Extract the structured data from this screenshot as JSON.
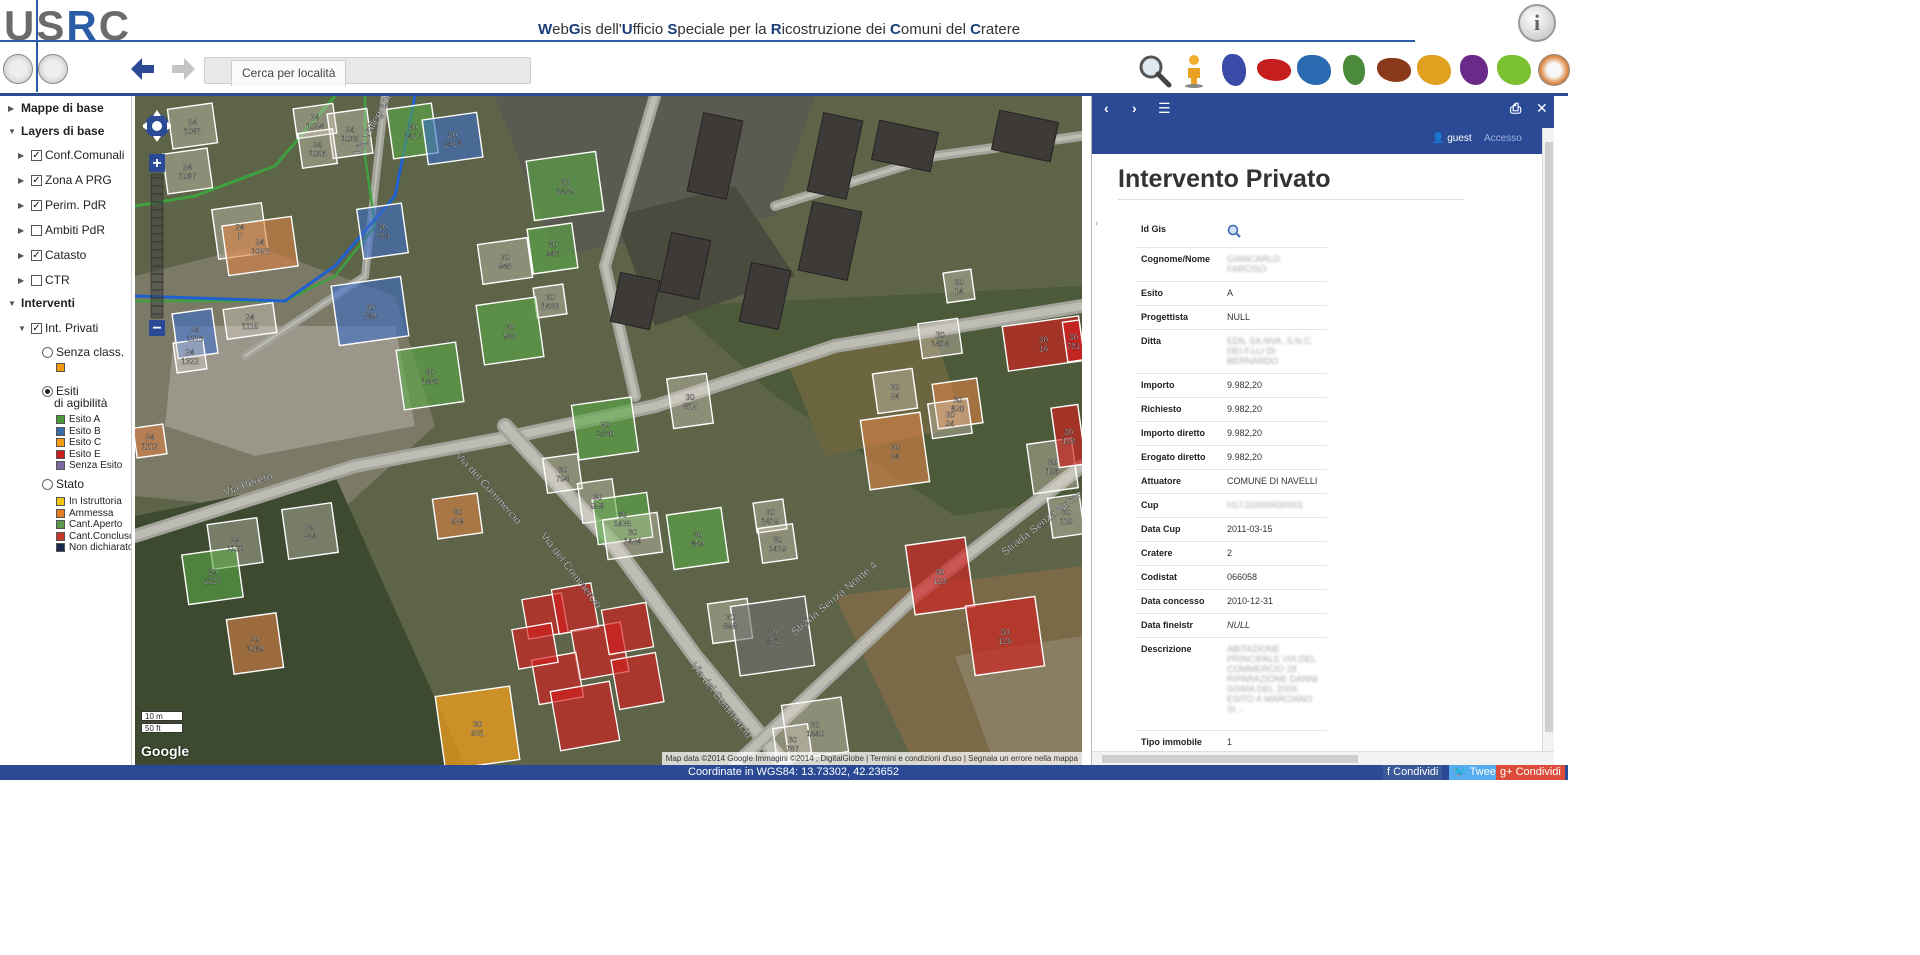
{
  "header": {
    "logo": {
      "u": "U",
      "s": "S",
      "r": "R",
      "c": "C"
    },
    "title_parts": [
      {
        "b": "W",
        "t": "eb"
      },
      {
        "b": "G",
        "t": "is dell'"
      },
      {
        "b": "U",
        "t": "fficio "
      },
      {
        "b": "S",
        "t": "peciale per la "
      },
      {
        "b": "R",
        "t": "icostruzione dei "
      },
      {
        "b": "C",
        "t": "omuni del "
      },
      {
        "b": "C",
        "t": "ratere"
      }
    ],
    "info_label": "i",
    "nav_back": "🡄",
    "nav_forward": "🡆",
    "search_tab_label": "Cerca per località"
  },
  "toolbar": {
    "icons": [
      "search-icon",
      "person-icon",
      "map-region-1",
      "map-region-2",
      "map-region-3",
      "map-region-4",
      "map-region-5",
      "map-region-6",
      "map-region-7",
      "map-region-8",
      "map-region-9"
    ],
    "map_colors": [
      "#3a4aa8",
      "#c41e1e",
      "#2a6ab0",
      "#4a8a3a",
      "#8a3a1a",
      "#e0a020",
      "#6a2a8a",
      "#7ac030"
    ]
  },
  "sidebar": {
    "sections": {
      "base_maps": "Mappe di base",
      "base_layers": "Layers di base",
      "interventi": "Interventi"
    },
    "layers": [
      {
        "label": "Conf.Comunali",
        "checked": true
      },
      {
        "label": "Zona A PRG",
        "checked": true
      },
      {
        "label": "Perim. PdR",
        "checked": true
      },
      {
        "label": "Ambiti PdR",
        "checked": false
      },
      {
        "label": "Catasto",
        "checked": true
      },
      {
        "label": "CTR",
        "checked": false
      }
    ],
    "int_privati": {
      "label": "Int. Privati",
      "checked": true
    },
    "radio_senza": "Senza class.",
    "radio_esiti_1": "Esiti",
    "radio_esiti_2": "di agibilità",
    "radio_stato": "Stato",
    "senza_color": "#f39c12",
    "esiti_legend": [
      {
        "label": "Esito A",
        "color": "#4a9a3a"
      },
      {
        "label": "Esito B",
        "color": "#3a6aa8"
      },
      {
        "label": "Esito C",
        "color": "#f39c12"
      },
      {
        "label": "Esito E",
        "color": "#c82020"
      },
      {
        "label": "Senza Esito",
        "color": "#7a6aa0"
      }
    ],
    "stato_legend": [
      {
        "label": "In Istruttoria",
        "color": "#f1c40f"
      },
      {
        "label": "Ammessa",
        "color": "#e67e22"
      },
      {
        "label": "Cant.Aperto",
        "color": "#5a9a4a"
      },
      {
        "label": "Cant.Concluso",
        "color": "#c0392b"
      },
      {
        "label": "Non dichiarato",
        "color": "#1a2a4a"
      }
    ]
  },
  "map": {
    "scale_m": "10 m",
    "scale_ft": "50 ft",
    "google": "Google",
    "attribution": "Map data ©2014 Google Immagini ©2014 , DigitalGlobe  |  Termini e condizioni d'uso  |  Segnala un errore nella mappa",
    "streets": [
      "Via del Commercio",
      "Via del Commercio",
      "Via del Commercio",
      "Strada Senza Nome 4",
      "Strada Senza Nome 4",
      "Via Pereto",
      "Via Vallegrande"
    ],
    "parcels": [
      {
        "a": "24",
        "b": "1081"
      },
      {
        "a": "24",
        "b": "1054"
      },
      {
        "a": "24",
        "b": "1055"
      },
      {
        "a": "24",
        "b": "1056"
      },
      {
        "a": "24",
        "b": "1087"
      },
      {
        "a": "30",
        "b": "1417"
      },
      {
        "a": "30",
        "b": "1418"
      },
      {
        "a": "30",
        "b": "1429"
      },
      {
        "a": "24",
        "b": "F"
      },
      {
        "a": "24",
        "b": "1093"
      },
      {
        "a": "30",
        "b": "788"
      },
      {
        "a": "30",
        "b": "946"
      },
      {
        "a": "30",
        "b": "947"
      },
      {
        "a": "30",
        "b": "1433"
      },
      {
        "a": "30",
        "b": "789"
      },
      {
        "a": "24",
        "b": "1113"
      },
      {
        "a": "24",
        "b": "1115"
      },
      {
        "a": "24",
        "b": "1322"
      },
      {
        "a": "30",
        "b": "933"
      },
      {
        "a": "30",
        "b": "1426"
      },
      {
        "a": "24",
        "b": "1112"
      },
      {
        "a": "30",
        "b": "1430"
      },
      {
        "a": "30",
        "b": "812"
      },
      {
        "a": "30",
        "b": "794"
      },
      {
        "a": "30",
        "b": "958"
      },
      {
        "a": "30",
        "b": "1435"
      },
      {
        "a": "30",
        "b": "929"
      },
      {
        "a": "30",
        "b": "1424"
      },
      {
        "a": "29",
        "b": "1111"
      },
      {
        "a": "29",
        "b": "234"
      },
      {
        "a": "29",
        "b": "1327"
      },
      {
        "a": "30",
        "b": "859"
      },
      {
        "a": "30",
        "b": "1419"
      },
      {
        "a": "30",
        "b": "1419"
      },
      {
        "a": "29",
        "b": "1089"
      },
      {
        "a": "30",
        "b": "898"
      },
      {
        "a": "30",
        "b": "861"
      },
      {
        "a": "30",
        "b": "931"
      },
      {
        "a": "30",
        "b": "1440"
      },
      {
        "a": "30",
        "b": "787"
      },
      {
        "a": "30",
        "b": "14"
      },
      {
        "a": "30",
        "b": "1414"
      },
      {
        "a": "30",
        "b": "24"
      },
      {
        "a": "30",
        "b": "820"
      },
      {
        "a": "30",
        "b": "24"
      },
      {
        "a": "30",
        "b": "24"
      },
      {
        "a": "30",
        "b": "106"
      },
      {
        "a": "30",
        "b": "110"
      },
      {
        "a": "30",
        "b": "123"
      },
      {
        "a": "30",
        "b": "126"
      },
      {
        "a": "30",
        "b": "16"
      },
      {
        "a": "30",
        "b": "781"
      },
      {
        "a": "30",
        "b": "103"
      }
    ]
  },
  "panel": {
    "user": "guest",
    "access": "Accesso",
    "title": "Intervento Privato",
    "rows": [
      {
        "k": "Id Gis",
        "v": "",
        "icon": "magnifier-icon"
      },
      {
        "k": "Cognome/Nome",
        "v": "GIANCARLO FARCISO",
        "blur": true
      },
      {
        "k": "Esito",
        "v": "A"
      },
      {
        "k": "Progettista",
        "v": "NULL"
      },
      {
        "k": "Ditta",
        "v": "EDIL SA.NVA. S.N.C. DEI F.LLI DI BERNARDO",
        "blur": true
      },
      {
        "k": "Importo",
        "v": "9.982,20"
      },
      {
        "k": "Richiesto",
        "v": "9.982,20"
      },
      {
        "k": "Importo diretto",
        "v": "9.982,20"
      },
      {
        "k": "Erogato diretto",
        "v": "9.982,20"
      },
      {
        "k": "Attuatore",
        "v": "COMUNE DI NAVELLI"
      },
      {
        "k": "Cup",
        "v": "H17J10000030001",
        "blur": true
      },
      {
        "k": "Data Cup",
        "v": "2011-03-15"
      },
      {
        "k": "Cratere",
        "v": "2"
      },
      {
        "k": "Codistat",
        "v": "066058"
      },
      {
        "k": "Data concesso",
        "v": "2010-12-31"
      },
      {
        "k": "Data fineistr",
        "v": "NULL",
        "italic": true
      },
      {
        "k": "Descrizione",
        "v": "ABITAZIONE PRINCIPALE VIA DEL COMMERCIO 28 RIPARAZIONE DANNI SISMA DEL 2009, ESITO A MARCIANO SI...",
        "blur": true
      },
      {
        "k": "Tipo immobile",
        "v": "1"
      }
    ]
  },
  "status": {
    "coords": "Coordinate in WGS84: 13.73302, 42.23652",
    "fb": "Condividi",
    "tw": "Tweet",
    "gp": "Condividi"
  }
}
